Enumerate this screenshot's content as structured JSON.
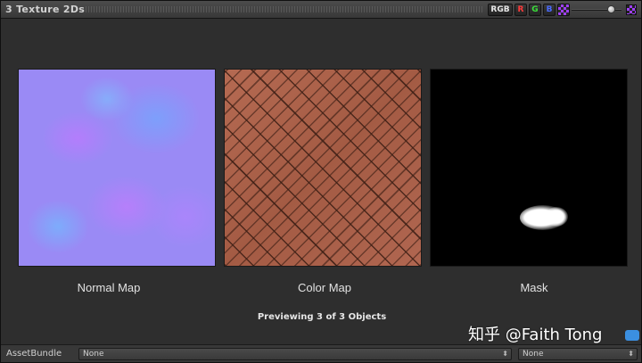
{
  "header": {
    "title": "3 Texture 2Ds",
    "channels": {
      "rgb": "RGB",
      "r": "R",
      "g": "G",
      "b": "B"
    },
    "alpha_icon": "alpha-checker-icon",
    "zoom_slider_level": 0.85
  },
  "textures": [
    {
      "label": "Normal Map"
    },
    {
      "label": "Color Map"
    },
    {
      "label": "Mask"
    }
  ],
  "preview_text": "Previewing 3 of 3 Objects",
  "watermark": "知乎 @Faith Tong",
  "bottom_bar": {
    "label": "AssetBundle",
    "bundle_name": "None",
    "bundle_variant": "None"
  },
  "colors": {
    "panel_bg": "#2e2e2e",
    "header_bg": "#3c3c3c",
    "channel_r": "#ff3a3a",
    "channel_g": "#3adf3a",
    "channel_b": "#4a6bff",
    "accent_purple": "#a040ff"
  }
}
